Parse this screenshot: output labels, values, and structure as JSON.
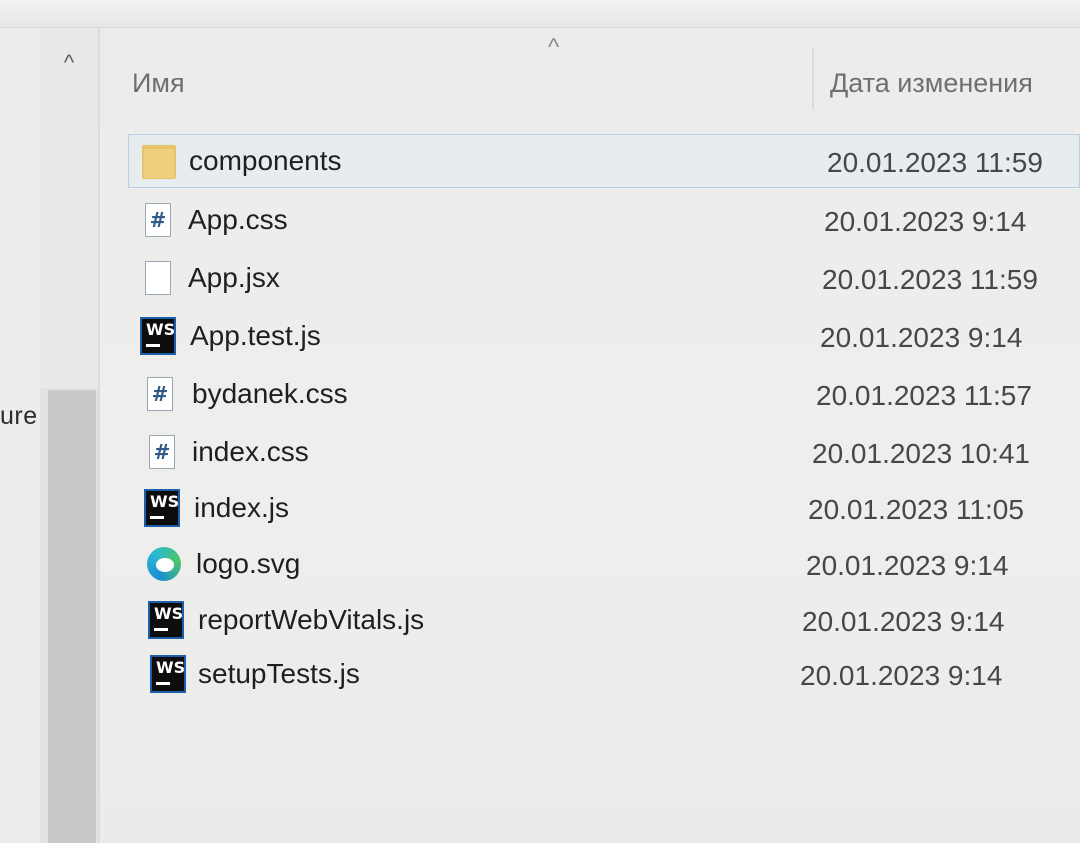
{
  "nav": {
    "partial_label": "ure",
    "scroll_up_glyph": "^"
  },
  "header": {
    "sort_indicator": "^",
    "name_column": "Имя",
    "date_column": "Дата изменения"
  },
  "files": [
    {
      "name": "components",
      "date": "20.01.2023 11:59",
      "icon": "folder-icon",
      "selected": true
    },
    {
      "name": "App.css",
      "date": "20.01.2023 9:14",
      "icon": "css-file-icon"
    },
    {
      "name": "App.jsx",
      "date": "20.01.2023 11:59",
      "icon": "jsx-file-icon"
    },
    {
      "name": "App.test.js",
      "date": "20.01.2023 9:14",
      "icon": "webstorm-file-icon"
    },
    {
      "name": "bydanek.css",
      "date": "20.01.2023 11:57",
      "icon": "css-file-icon"
    },
    {
      "name": "index.css",
      "date": "20.01.2023 10:41",
      "icon": "css-file-icon"
    },
    {
      "name": "index.js",
      "date": "20.01.2023 11:05",
      "icon": "webstorm-file-icon"
    },
    {
      "name": "logo.svg",
      "date": "20.01.2023 9:14",
      "icon": "edge-file-icon"
    },
    {
      "name": "reportWebVitals.js",
      "date": "20.01.2023 9:14",
      "icon": "webstorm-file-icon"
    },
    {
      "name": "setupTests.js",
      "date": "20.01.2023 9:14",
      "icon": "webstorm-file-icon"
    }
  ],
  "icon_glyphs": {
    "css": "#",
    "ws": "WS"
  },
  "colors": {
    "selection_border": "#b9cfe4",
    "folder": "#e6c36a",
    "webstorm_bg": "#0d0d0d",
    "webstorm_border": "#1b5fa8"
  }
}
